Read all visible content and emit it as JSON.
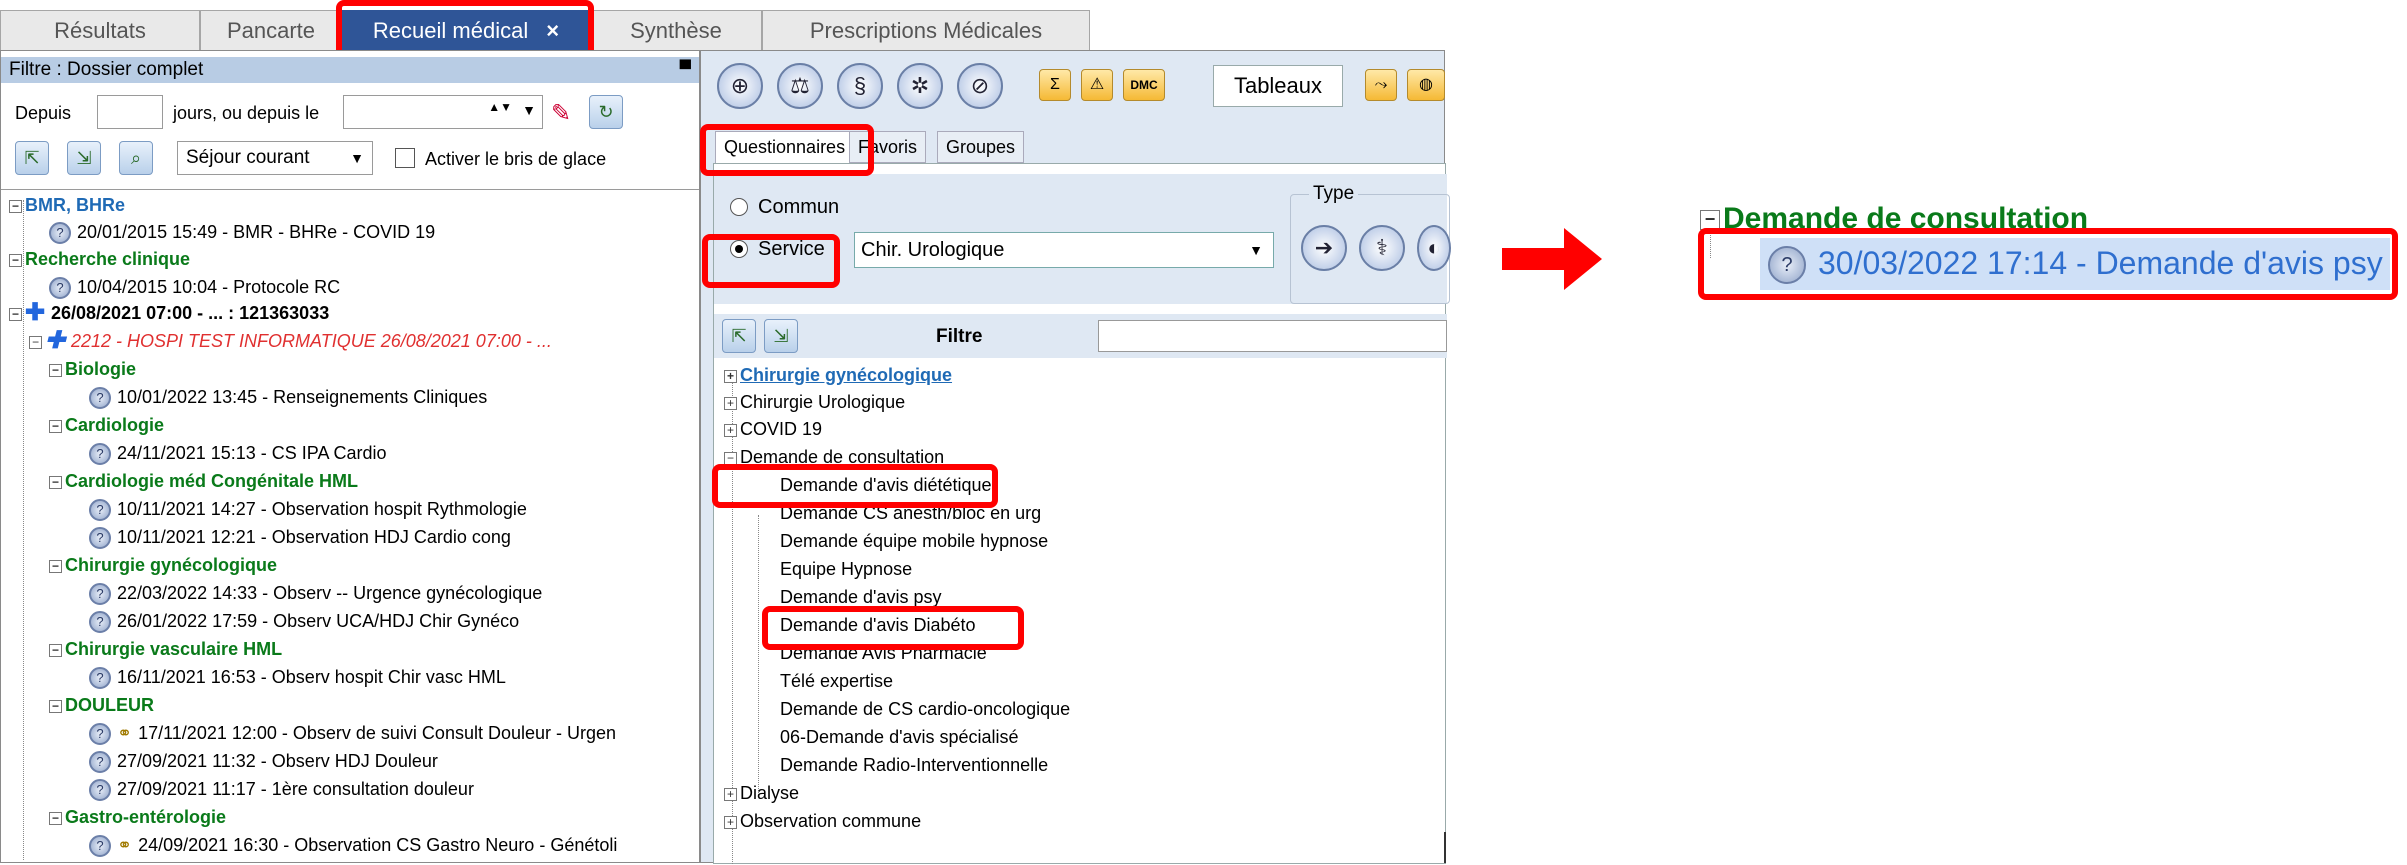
{
  "tabs": [
    {
      "label": "Résultats",
      "active": false
    },
    {
      "label": "Pancarte",
      "active": false
    },
    {
      "label": "Recueil médical",
      "active": true,
      "close": "×"
    },
    {
      "label": "Synthèse",
      "active": false
    },
    {
      "label": "Prescriptions Médicales",
      "active": false
    }
  ],
  "left": {
    "filter_title": "Filtre : Dossier complet",
    "pin": "📌",
    "depuis_label": "Depuis",
    "jours_label": "jours, ou depuis le",
    "sejour_select": "Séjour courant",
    "bris_label": "Activer le bris de glace",
    "tree": {
      "bmr": "BMR, BHRe",
      "bmr_1": "20/01/2015 15:49 - BMR - BHRe - COVID 19",
      "rc": "Recherche clinique",
      "rc_1": "10/04/2015 10:04 - Protocole RC",
      "sejour": "26/08/2021 07:00 - ... : 121363033",
      "hospi": "2212 - HOSPI TEST INFORMATIQUE 26/08/2021 07:00 - ...",
      "bio": "Biologie",
      "bio_1": "10/01/2022 13:45 - Renseignements Cliniques",
      "cardio": "Cardiologie",
      "cardio_1": "24/11/2021 15:13 - CS IPA Cardio",
      "cardio_cong": "Cardiologie méd Congénitale HML",
      "cardio_cong_1": "10/11/2021 14:27 - Observation hospit Rythmologie",
      "cardio_cong_2": "10/11/2021 12:21 - Observation HDJ Cardio cong",
      "gyneco": "Chirurgie gynécologique",
      "gyneco_1": "22/03/2022 14:33 - Observ -- Urgence gynécologique",
      "gyneco_2": "26/01/2022 17:59 - Observ UCA/HDJ Chir Gynéco",
      "vasc": "Chirurgie vasculaire HML",
      "vasc_1": "16/11/2021 16:53 - Observ hospit Chir vasc HML",
      "douleur": "DOULEUR",
      "douleur_1": "17/11/2021 12:00 - Observ de suivi Consult Douleur - Urgen",
      "douleur_2": "27/09/2021 11:32 - Observ HDJ  Douleur",
      "douleur_3": "27/09/2021 11:17 - 1ère consultation douleur",
      "gastro": "Gastro-entérologie",
      "gastro_1": "24/09/2021 16:30 - Observation CS Gastro Neuro - Génétoli"
    }
  },
  "right": {
    "tableaux": "Tableaux",
    "dmc": "DMC",
    "qtabs": [
      "Questionnaires",
      "Favoris",
      "Groupes"
    ],
    "commun": "Commun",
    "service": "Service",
    "service_value": "Chir. Urologique",
    "type_label": "Type",
    "filtre_label": "Filtre",
    "items": [
      "Chirurgie gynécologique",
      "Chirurgie Urologique",
      "COVID 19",
      "Demande de consultation",
      "Demande d'avis diététique",
      "Demande CS anesth/bloc en urg",
      "Demande équipe mobile hypnose",
      "Equipe Hypnose",
      "Demande d'avis psy",
      "Demande d'avis Diabéto",
      "Demande Avis Pharmacie",
      "Télé expertise",
      "Demande de CS cardio-oncologique",
      "06-Demande d'avis spécialisé",
      "Demande Radio-Interventionnelle",
      "Dialyse",
      "Observation commune"
    ]
  },
  "zoom": {
    "group": "Demande de consultation",
    "entry": "30/03/2022 17:14 - Demande d'avis psy"
  },
  "colors": {
    "highlight": "#ff0000",
    "active_tab": "#2f5597",
    "group_green": "#0a7a1a",
    "selection": "#cfe0f7"
  }
}
